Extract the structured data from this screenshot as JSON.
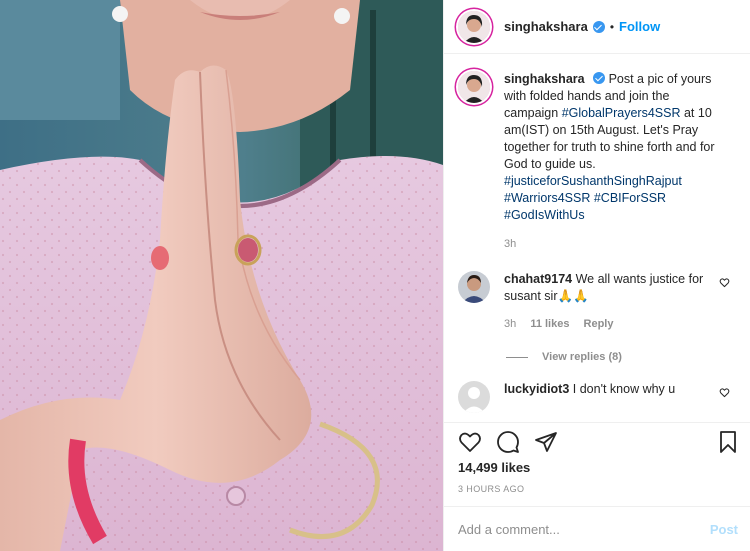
{
  "post": {
    "username": "singhakshara",
    "follow_label": "Follow",
    "separator": "•"
  },
  "caption": {
    "username": "singhakshara",
    "text_1": "Post a pic of yours with folded hands and join the campaign ",
    "tag_1": "#GlobalPrayers4SSR",
    "text_2": " at 10 am(IST) on 15th August. Let's Pray together for truth to shine forth and for God to guide us. ",
    "tag_2": "#justiceforSushanthSinghRajput",
    "tag_3": "#Warriors4SSR",
    "tag_4": "#CBIForSSR",
    "tag_5": "#GodIsWithUs",
    "time": "3h"
  },
  "comments": [
    {
      "username": "chahat9174",
      "text": "We all wants justice for susant sir🙏🙏",
      "time": "3h",
      "likes": "11 likes",
      "reply_label": "Reply",
      "view_replies": "View replies (8)"
    },
    {
      "username": "luckyidiot3",
      "text": "I don't know why u"
    }
  ],
  "footer": {
    "likes": "14,499 likes",
    "posted_ago": "3 HOURS AGO",
    "add_comment_placeholder": "Add a comment...",
    "post_label": "Post"
  },
  "icons": {
    "like": "heart-icon",
    "comment": "comment-icon",
    "share": "share-icon",
    "save": "bookmark-icon",
    "verified": "verified-badge-icon"
  },
  "colors": {
    "link": "#0095f6",
    "hashtag": "#00376b",
    "muted": "#8e8e8e",
    "verified": "#3897f0",
    "post_disabled": "#b2dffc"
  }
}
